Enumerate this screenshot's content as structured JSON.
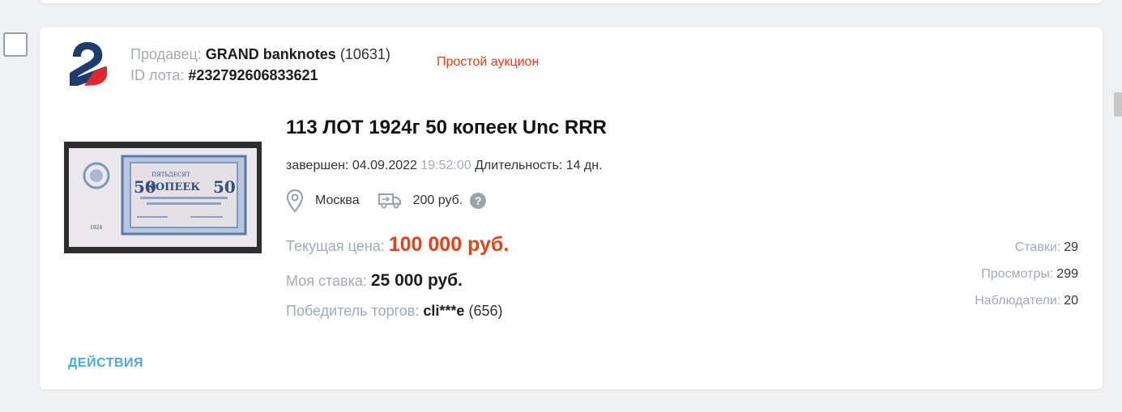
{
  "seller": {
    "label": "Продавец:",
    "name": "GRAND banknotes",
    "rating": "(10631)",
    "lot_id_label": "ID лота:",
    "lot_id": "#232792606833621"
  },
  "auction_type": "Простой аукцион",
  "lot": {
    "title": "113 ЛОТ 1924г 50 копеек Unc RRR",
    "ended_label": "завершен:",
    "ended_date": "04.09.2022",
    "ended_time": "19:52:00",
    "duration_label": "Длительность:",
    "duration_value": "14 дн.",
    "location": "Москва",
    "shipping": "200 руб.",
    "help_glyph": "?"
  },
  "price": {
    "current_label": "Текущая цена:",
    "current_value": "100 000 руб.",
    "my_bid_label": "Моя ставка:",
    "my_bid_value": "25 000 руб.",
    "winner_label": "Победитель торгов:",
    "winner_name": "cli***e",
    "winner_rating": "(656)"
  },
  "stats": {
    "bids_label": "Ставки:",
    "bids_value": "29",
    "views_label": "Просмотры:",
    "views_value": "299",
    "watchers_label": "Наблюдатели:",
    "watchers_value": "20"
  },
  "banknote": {
    "denomination": "50",
    "text_top": "ПЯТЬДЕСЯТ",
    "text_main": "КОПЕЕК",
    "year": "1924"
  },
  "actions_label": "ДЕЙСТВИЯ",
  "icons": {
    "location": "map-pin-icon",
    "shipping": "truck-icon",
    "help": "question-circle-icon"
  },
  "colors": {
    "accent_red": "#e8401b",
    "link_blue": "#4aa8e8",
    "muted_gray": "#a2abb6",
    "logo_navy": "#1e3c6e",
    "logo_red": "#e0262f"
  }
}
